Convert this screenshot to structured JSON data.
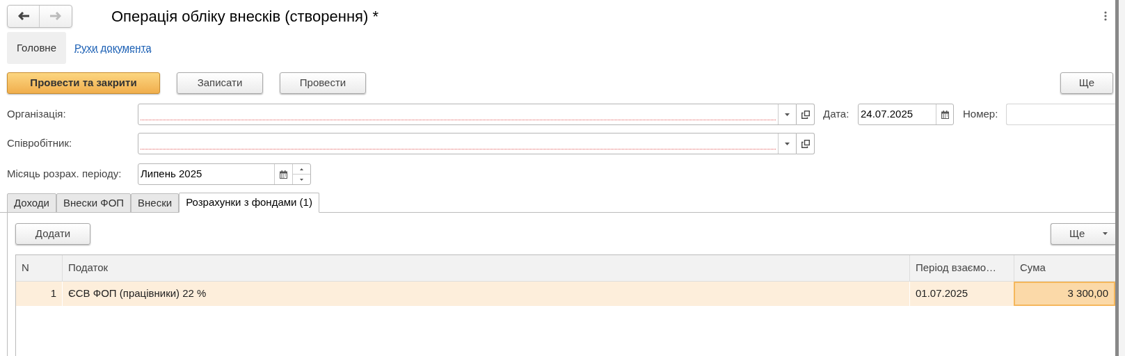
{
  "nav": {
    "back": {
      "disabled": false
    },
    "forward": {
      "disabled": true
    }
  },
  "window": {
    "title": "Операція обліку внесків (створення) *"
  },
  "sections": [
    {
      "label": "Головне",
      "selected": true
    },
    {
      "label": "Рухи документа",
      "selected": false
    }
  ],
  "command_bar": {
    "buttons": [
      {
        "label": "Провести та закрити",
        "kind": "primary"
      },
      {
        "label": "Записати",
        "kind": "default"
      },
      {
        "label": "Провести",
        "kind": "default"
      }
    ],
    "more": "Ще"
  },
  "fields": {
    "organization": {
      "label": "Організація:",
      "required": true
    },
    "date": {
      "label": "Дата:",
      "value": "24.07.2025"
    },
    "number": {
      "label": "Номер:"
    },
    "employee": {
      "label": "Співробітник:",
      "required": true
    },
    "period": {
      "label": "Місяць розрах. періоду:",
      "value": "Липень 2025"
    }
  },
  "tabs": [
    {
      "label": "Доходи",
      "selected": false
    },
    {
      "label": "Внески ФОП",
      "selected": false
    },
    {
      "label": "Внески",
      "selected": false
    },
    {
      "label": "Розрахунки з фондами (1)",
      "selected": true
    }
  ],
  "table": {
    "add_button": "Додати",
    "more": "Ще",
    "columns": [
      "N",
      "Податок",
      "Період взаємо…",
      "Сума"
    ],
    "rows": [
      {
        "selected": true,
        "cells": [
          {
            "text": "1",
            "focused": false
          },
          {
            "text": "ЄСВ ФОП (працівники) 22 %",
            "focused": false
          },
          {
            "text": "01.07.2025",
            "focused": false
          },
          {
            "text": "3 300,00",
            "focused": true
          }
        ]
      }
    ]
  }
}
